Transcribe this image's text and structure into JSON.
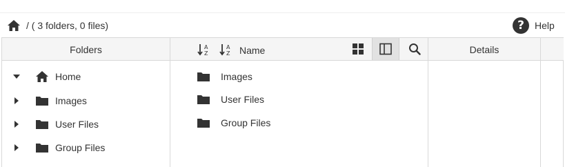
{
  "path": {
    "home_icon": "home-icon",
    "separator_text": "/ ( 3 folders, 0 files)"
  },
  "help": {
    "icon": "question-circle-icon",
    "label": "Help"
  },
  "panes": {
    "folders_title": "Folders",
    "files_sort_label": "Name",
    "details_title": "Details"
  },
  "toolbar": {
    "sort_asc_icon": "sort-alpha-asc-icon",
    "sort_desc_icon": "sort-alpha-desc-icon",
    "grid_view_icon": "grid-view-icon",
    "column_view_icon": "column-view-icon",
    "column_view_active": true,
    "search_icon": "search-icon"
  },
  "tree": [
    {
      "label": "Home",
      "icon": "home-icon",
      "expanded": true
    },
    {
      "label": "Images",
      "icon": "folder-icon",
      "expanded": false
    },
    {
      "label": "User Files",
      "icon": "folder-icon",
      "expanded": false
    },
    {
      "label": "Group Files",
      "icon": "folder-icon",
      "expanded": false
    }
  ],
  "files": [
    {
      "label": "Images",
      "icon": "folder-icon"
    },
    {
      "label": "User Files",
      "icon": "folder-icon"
    },
    {
      "label": "Group Files",
      "icon": "folder-icon"
    }
  ],
  "colors": {
    "text": "#333333",
    "header_bg": "#f5f5f5",
    "border": "#d8d8d8",
    "active_btn_bg": "#e2e2e2"
  }
}
